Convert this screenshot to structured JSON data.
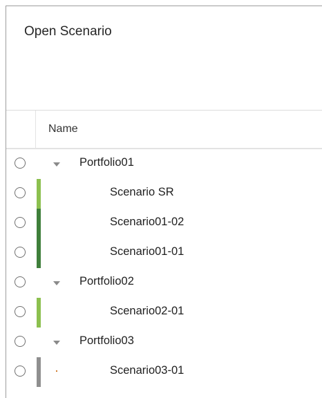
{
  "dialog": {
    "title": "Open Scenario"
  },
  "table": {
    "columns": [
      "Name"
    ],
    "rows": [
      {
        "type": "portfolio",
        "name": "Portfolio01",
        "expanded": true,
        "bar_color": ""
      },
      {
        "type": "scenario",
        "name": "Scenario SR",
        "bar_color": "#8cc04f"
      },
      {
        "type": "scenario",
        "name": "Scenario01-02",
        "bar_color": "#3f7f3b"
      },
      {
        "type": "scenario",
        "name": "Scenario01-01",
        "bar_color": "#3f7f3b"
      },
      {
        "type": "portfolio",
        "name": "Portfolio02",
        "expanded": true,
        "bar_color": ""
      },
      {
        "type": "scenario",
        "name": "Scenario02-01",
        "bar_color": "#8cc04f"
      },
      {
        "type": "portfolio",
        "name": "Portfolio03",
        "expanded": true,
        "bar_color": ""
      },
      {
        "type": "scenario",
        "name": "Scenario03-01",
        "bar_color": "#8f8f8f",
        "marker": "orange-dot"
      }
    ]
  },
  "colors": {
    "light_green": "#8cc04f",
    "dark_green": "#3f7f3b",
    "gray": "#8f8f8f",
    "orange_marker": "#d07a2b"
  }
}
